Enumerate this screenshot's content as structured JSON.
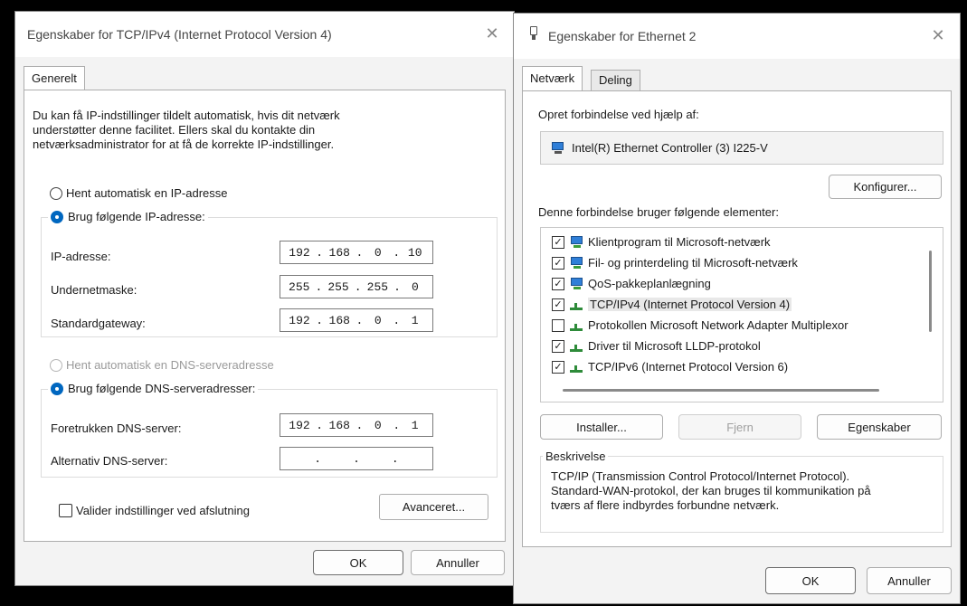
{
  "tcp_dialog": {
    "title": "Egenskaber for TCP/IPv4 (Internet Protocol Version 4)",
    "tab_general": "Generelt",
    "intro_line1": "Du kan få IP-indstillinger tildelt automatisk, hvis dit netværk",
    "intro_line2": "understøtter denne facilitet. Ellers skal du kontakte din",
    "intro_line3": "netværksadministrator for at få de korrekte IP-indstillinger.",
    "radio_auto_ip": "Hent automatisk en IP-adresse",
    "radio_manual_ip": "Brug følgende IP-adresse:",
    "ip_label": "IP-adresse:",
    "ip": [
      "192",
      "168",
      "0",
      "10"
    ],
    "subnet_label": "Undernetmaske:",
    "subnet": [
      "255",
      "255",
      "255",
      "0"
    ],
    "gateway_label": "Standardgateway:",
    "gateway": [
      "192",
      "168",
      "0",
      "1"
    ],
    "radio_auto_dns": "Hent automatisk en DNS-serveradresse",
    "radio_manual_dns": "Brug følgende DNS-serveradresser:",
    "pref_dns_label": "Foretrukken DNS-server:",
    "pref_dns": [
      "192",
      "168",
      "0",
      "1"
    ],
    "alt_dns_label": "Alternativ DNS-server:",
    "alt_dns": [
      "",
      "",
      "",
      ""
    ],
    "validate_label": "Valider indstillinger ved afslutning",
    "advanced_button": "Avanceret...",
    "ok_button": "OK",
    "cancel_button": "Annuller"
  },
  "eth_dialog": {
    "title": "Egenskaber for Ethernet 2",
    "tab_network": "Netværk",
    "tab_sharing": "Deling",
    "connect_using_label": "Opret forbindelse ved hjælp af:",
    "adapter_name": "Intel(R) Ethernet Controller (3) I225-V",
    "configure_button": "Konfigurer...",
    "items_label": "Denne forbindelse bruger følgende elementer:",
    "items": [
      {
        "label": "Klientprogram til Microsoft-netværk",
        "checked": true,
        "icon": "network-client-icon"
      },
      {
        "label": "Fil- og printerdeling til Microsoft-netværk",
        "checked": true,
        "icon": "network-client-icon"
      },
      {
        "label": "QoS-pakkeplanlægning",
        "checked": true,
        "icon": "network-client-icon"
      },
      {
        "label": "TCP/IPv4 (Internet Protocol Version 4)",
        "checked": true,
        "icon": "protocol-icon",
        "selected": true
      },
      {
        "label": "Protokollen Microsoft Network Adapter Multiplexor",
        "checked": false,
        "icon": "protocol-icon"
      },
      {
        "label": "Driver til Microsoft LLDP-protokol",
        "checked": true,
        "icon": "protocol-icon"
      },
      {
        "label": "TCP/IPv6 (Internet Protocol Version 6)",
        "checked": true,
        "icon": "protocol-icon"
      }
    ],
    "install_button": "Installer...",
    "remove_button": "Fjern",
    "properties_button": "Egenskaber",
    "description_label": "Beskrivelse",
    "description_line1": "TCP/IP (Transmission Control Protocol/Internet Protocol).",
    "description_line2": "Standard-WAN-protokol, der kan bruges til kommunikation på",
    "description_line3": "tværs af flere indbyrdes forbundne netværk.",
    "ok_button": "OK",
    "cancel_button": "Annuller"
  }
}
